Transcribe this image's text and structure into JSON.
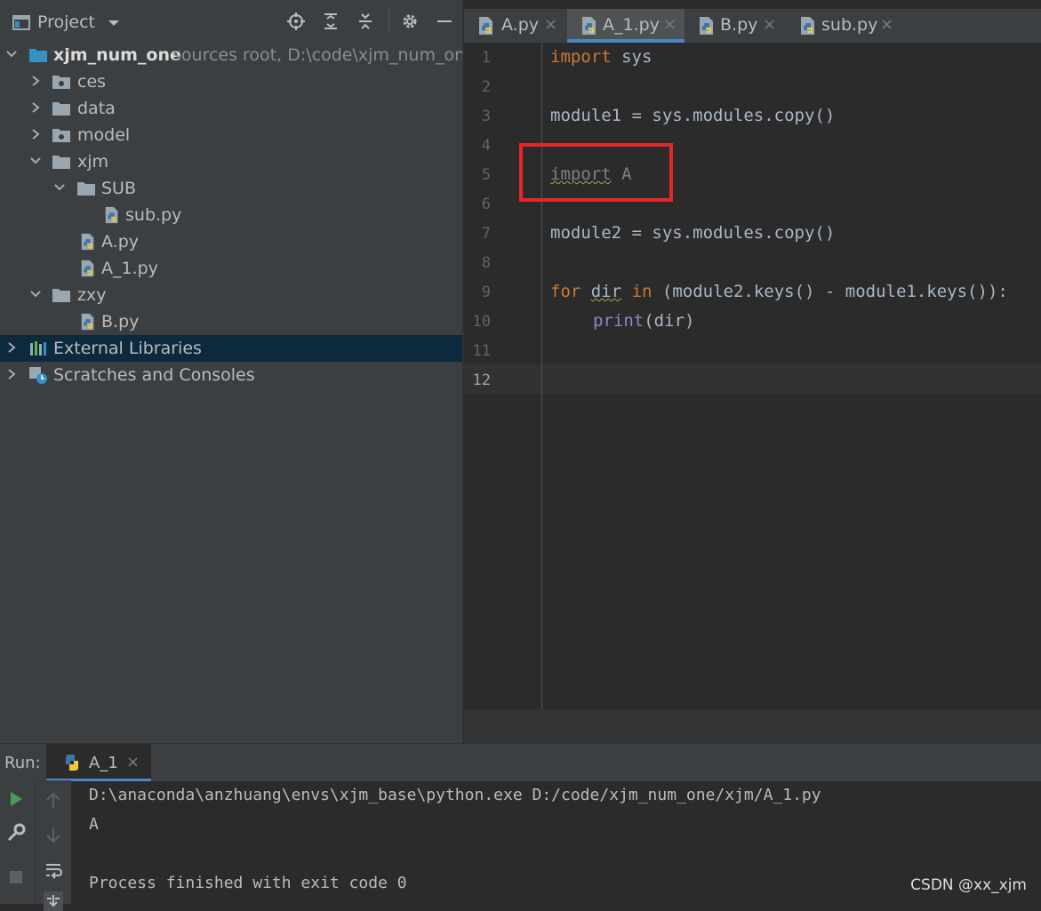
{
  "project": {
    "title": "Project",
    "tree": [
      {
        "label": "xjm_num_one",
        "suffix": "sources root,  D:\\code\\xjm_num_one"
      },
      {
        "label": "ces"
      },
      {
        "label": "data"
      },
      {
        "label": "model"
      },
      {
        "label": "xjm"
      },
      {
        "label": "SUB"
      },
      {
        "label": "sub.py"
      },
      {
        "label": "A.py"
      },
      {
        "label": "A_1.py"
      },
      {
        "label": "zxy"
      },
      {
        "label": "B.py"
      },
      {
        "label": "External Libraries"
      },
      {
        "label": "Scratches and Consoles"
      }
    ]
  },
  "tabs": [
    {
      "label": "A.py",
      "close": "×"
    },
    {
      "label": "A_1.py",
      "close": "×",
      "active": true
    },
    {
      "label": "B.py",
      "close": "×"
    },
    {
      "label": "sub.py",
      "close": "×"
    }
  ],
  "editor": {
    "line_numbers": [
      "1",
      "2",
      "3",
      "4",
      "5",
      "6",
      "7",
      "8",
      "9",
      "10",
      "11",
      "12"
    ],
    "code": {
      "l1_kw": "import",
      "l1_rest": " sys",
      "l3": "module1 = sys.modules.copy()",
      "l5_kw": "import",
      "l5_rest": " A",
      "l7": "module2 = sys.modules.copy()",
      "l9_for": "for",
      "l9_var": "dir",
      "l9_in": "in",
      "l9_rest": " (module2.keys() - module1.keys()):",
      "l10_fn": "print",
      "l10_rest": "(dir)"
    }
  },
  "run": {
    "label": "Run:",
    "tab": "A_1",
    "tab_close": "×",
    "output": [
      "D:\\anaconda\\anzhuang\\envs\\xjm_base\\python.exe D:/code/xjm_num_one/xjm/A_1.py",
      "A",
      "",
      "Process finished with exit code 0"
    ]
  },
  "watermark": "CSDN @xx_xjm",
  "colors": {
    "keyword": "#cc7832",
    "builtin": "#8888c6",
    "highlight_box": "#e8262a",
    "accent": "#4a88c7"
  }
}
